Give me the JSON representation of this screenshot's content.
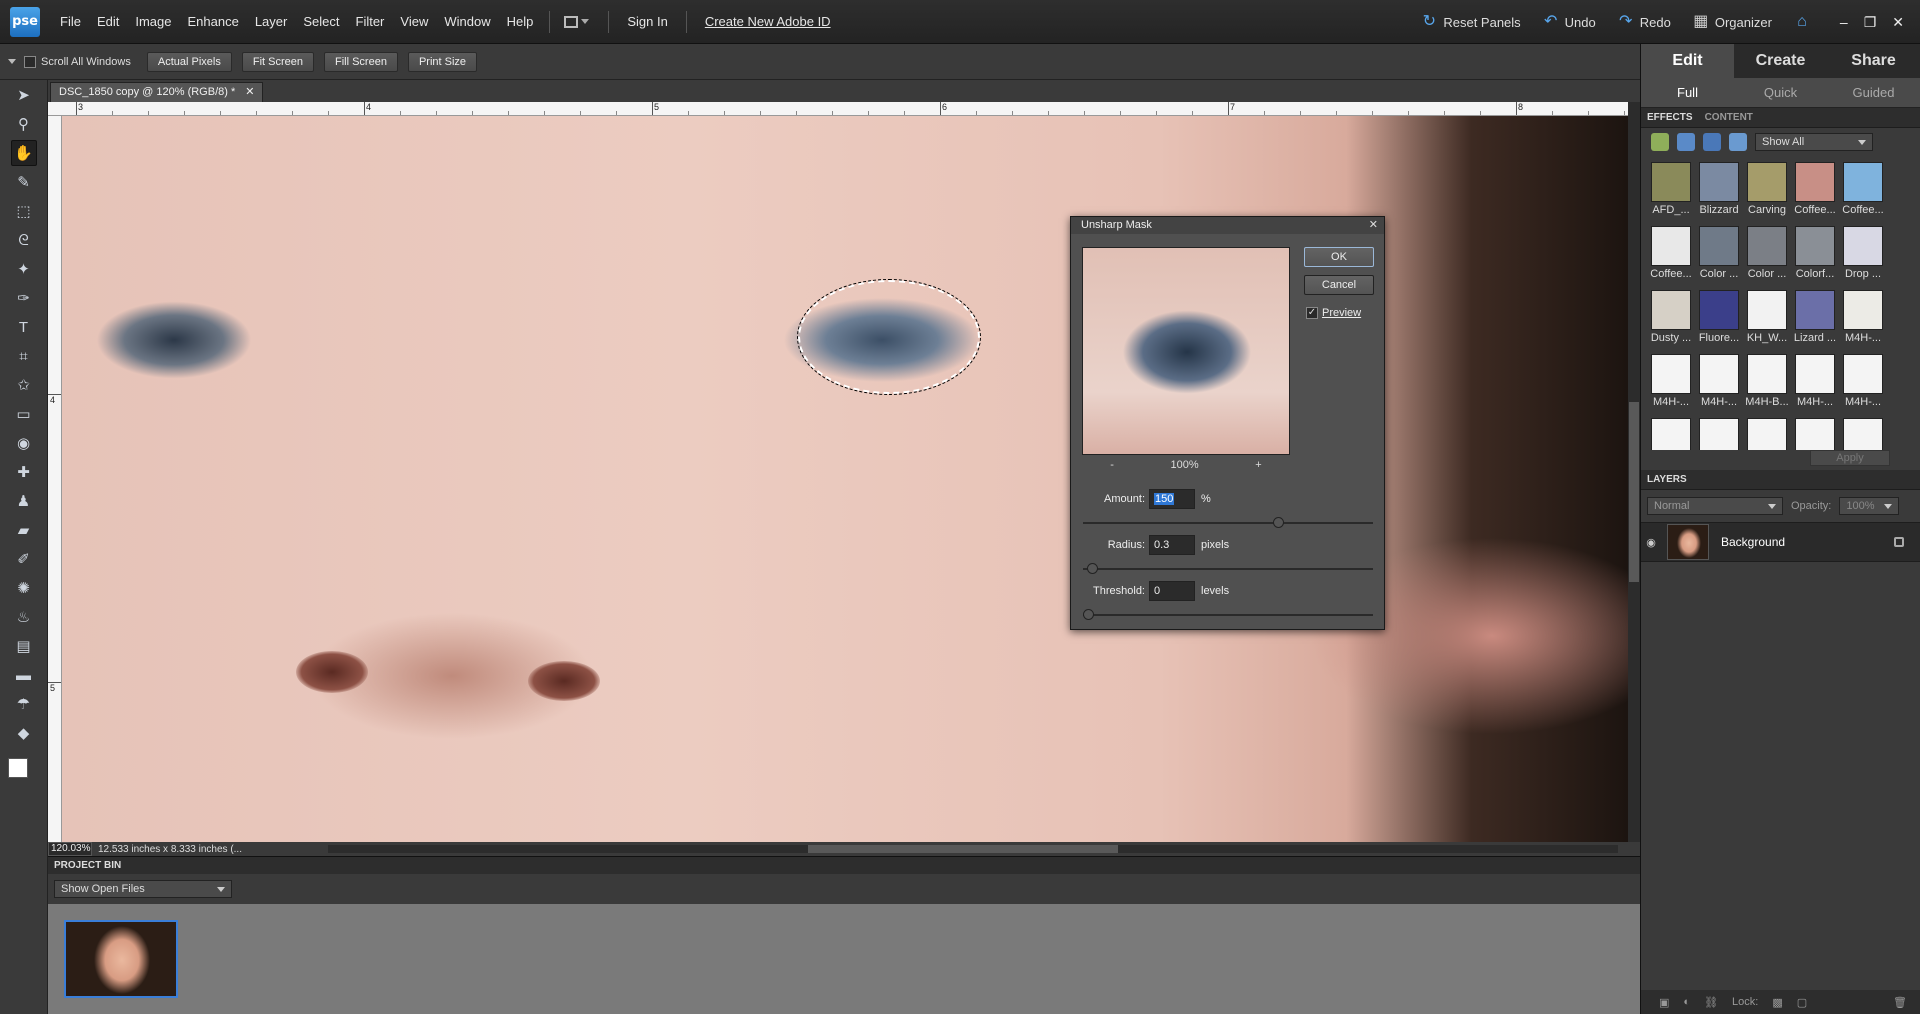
{
  "app": {
    "logo": "pse",
    "menu": [
      "File",
      "Edit",
      "Image",
      "Enhance",
      "Layer",
      "Select",
      "Filter",
      "View",
      "Window",
      "Help"
    ],
    "sign_in": "Sign In",
    "create_id": "Create New Adobe ID",
    "reset_panels": "Reset Panels",
    "undo": "Undo",
    "redo": "Redo",
    "organizer": "Organizer"
  },
  "options_bar": {
    "scroll_all": "Scroll All Windows",
    "buttons": [
      "Actual Pixels",
      "Fit Screen",
      "Fill Screen",
      "Print Size"
    ]
  },
  "document": {
    "tab_title": "DSC_1850 copy @ 120% (RGB/8) *",
    "zoom": "120.03%",
    "info": "12.533 inches x 8.333 inches (...",
    "ruler_labels": [
      "3",
      "4",
      "5",
      "6",
      "7",
      "8"
    ],
    "ruler_v_labels": [
      "4",
      "5"
    ]
  },
  "project_bin": {
    "title": "PROJECT BIN",
    "filter": "Show Open Files"
  },
  "right_panel": {
    "mode_tabs": [
      "Edit",
      "Create",
      "Share"
    ],
    "sub_tabs": [
      "Full",
      "Quick",
      "Guided"
    ],
    "effects_tab": "EFFECTS",
    "content_tab": "CONTENT",
    "show_filter": "Show All",
    "apply": "Apply",
    "effects": [
      {
        "label": "AFD_...",
        "color": "#8a8a5a"
      },
      {
        "label": "Blizzard",
        "color": "#7b8aa2"
      },
      {
        "label": "Carving",
        "color": "#a59c6a"
      },
      {
        "label": "Coffee...",
        "color": "#c88f86"
      },
      {
        "label": "Coffee...",
        "color": "#7fb3dd"
      },
      {
        "label": "Coffee...",
        "color": "#e8e8e8"
      },
      {
        "label": "Color ...",
        "color": "#6f7a88"
      },
      {
        "label": "Color ...",
        "color": "#7b7f86"
      },
      {
        "label": "Colorf...",
        "color": "#8a8f96"
      },
      {
        "label": "Drop ...",
        "color": "#d8d8e4"
      },
      {
        "label": "Dusty ...",
        "color": "#d6d0c6"
      },
      {
        "label": "Fluore...",
        "color": "#3b3f8a"
      },
      {
        "label": "KH_W...",
        "color": "#f2f2f2"
      },
      {
        "label": "Lizard ...",
        "color": "#6b6fa8"
      },
      {
        "label": "M4H-...",
        "color": "#ecebe6"
      },
      {
        "label": "M4H-...",
        "color": "#f4f4f4"
      },
      {
        "label": "M4H-...",
        "color": "#f4f4f4"
      },
      {
        "label": "M4H-B...",
        "color": "#f4f4f4"
      },
      {
        "label": "M4H-...",
        "color": "#f4f4f4"
      },
      {
        "label": "M4H-...",
        "color": "#f4f4f4"
      },
      {
        "label": "",
        "color": "#f4f4f4"
      },
      {
        "label": "",
        "color": "#f4f4f4"
      },
      {
        "label": "",
        "color": "#f4f4f4"
      },
      {
        "label": "",
        "color": "#f4f4f4"
      },
      {
        "label": "",
        "color": "#f4f4f4"
      }
    ],
    "layers_title": "LAYERS",
    "blend_mode": "Normal",
    "opacity_label": "Opacity:",
    "opacity_value": "100%",
    "layer_name": "Background",
    "lock_label": "Lock:"
  },
  "dialog": {
    "title": "Unsharp Mask",
    "ok": "OK",
    "cancel": "Cancel",
    "preview": "Preview",
    "zoom_minus": "-",
    "zoom_value": "100%",
    "zoom_plus": "+",
    "amount_label": "Amount:",
    "amount_value": "150",
    "amount_unit": "%",
    "radius_label": "Radius:",
    "radius_value": "0.3",
    "radius_unit": "pixels",
    "threshold_label": "Threshold:",
    "threshold_value": "0",
    "threshold_unit": "levels"
  }
}
